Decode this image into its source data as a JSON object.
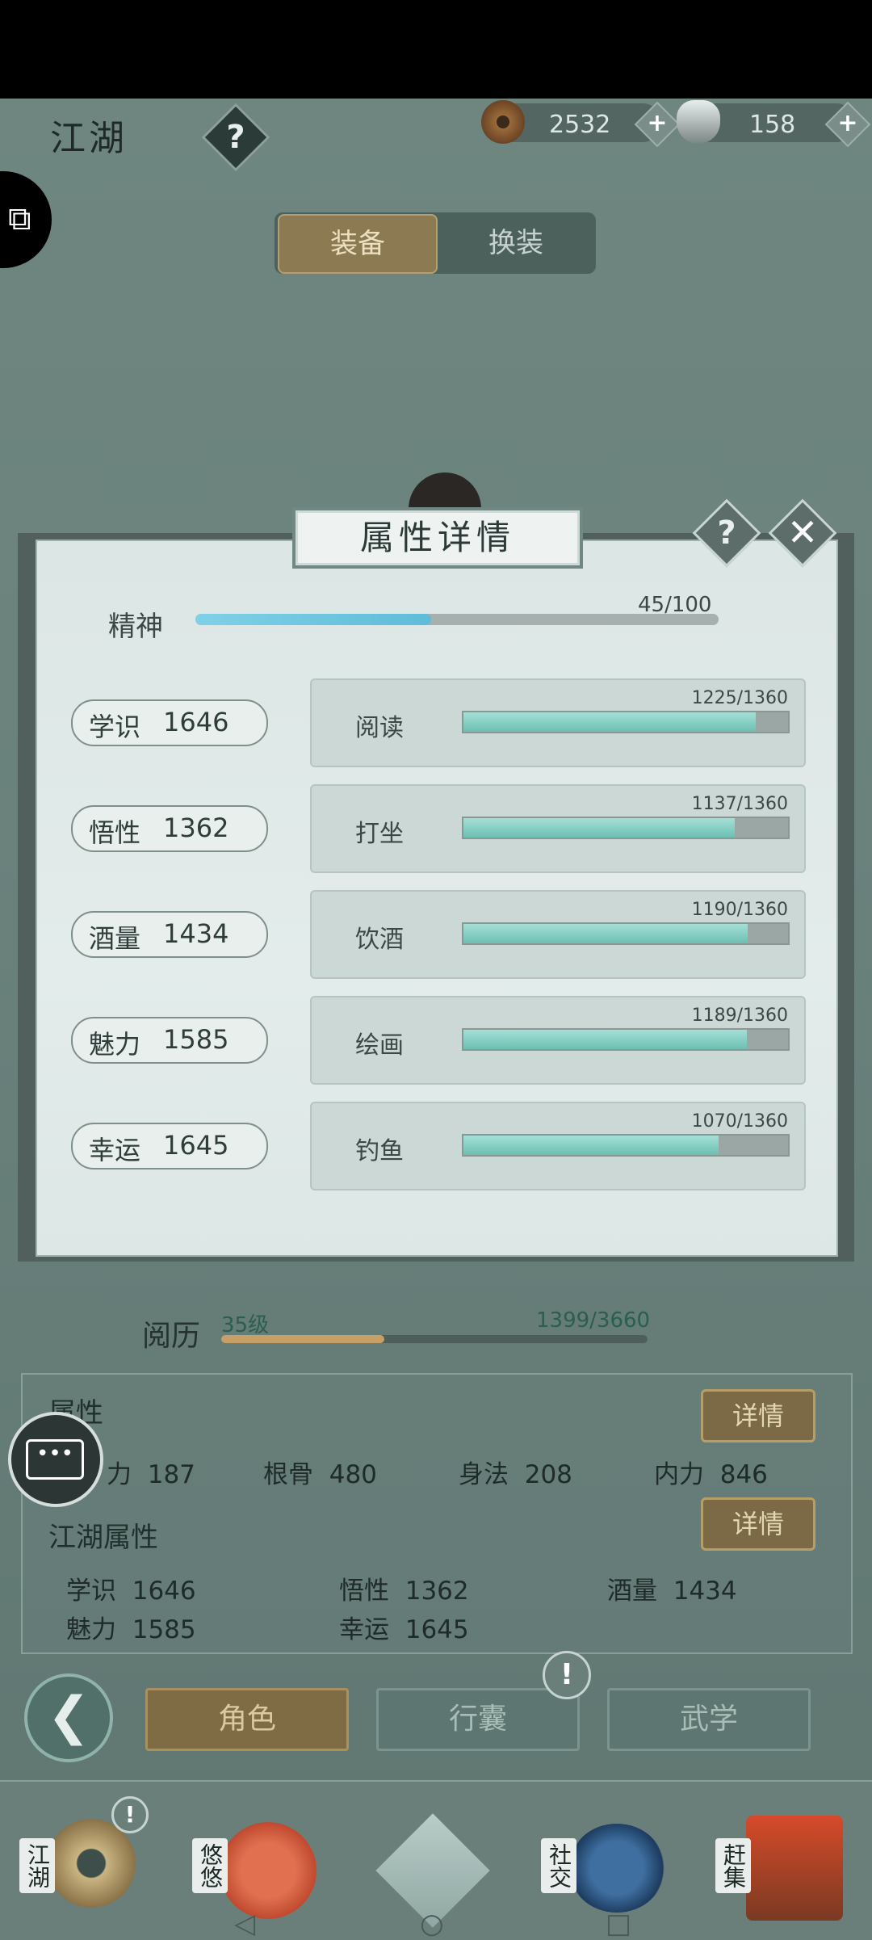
{
  "header": {
    "title": "江湖",
    "help": "?",
    "copper": "2532",
    "silver": "158",
    "plus": "+"
  },
  "segment": {
    "equip": "装备",
    "outfit": "换装"
  },
  "modal": {
    "title": "属性详情",
    "help": "?",
    "close": "✕",
    "spirit": {
      "label": "精神",
      "value": "45/100",
      "current": 45,
      "max": 100
    },
    "stats": [
      {
        "name": "学识",
        "value": "1646"
      },
      {
        "name": "悟性",
        "value": "1362"
      },
      {
        "name": "酒量",
        "value": "1434"
      },
      {
        "name": "魅力",
        "value": "1585"
      },
      {
        "name": "幸运",
        "value": "1645"
      }
    ],
    "activities": [
      {
        "name": "阅读",
        "progress": "1225/1360",
        "current": 1225,
        "max": 1360
      },
      {
        "name": "打坐",
        "progress": "1137/1360",
        "current": 1137,
        "max": 1360
      },
      {
        "name": "饮酒",
        "progress": "1190/1360",
        "current": 1190,
        "max": 1360
      },
      {
        "name": "绘画",
        "progress": "1189/1360",
        "current": 1189,
        "max": 1360
      },
      {
        "name": "钓鱼",
        "progress": "1070/1360",
        "current": 1070,
        "max": 1360
      }
    ]
  },
  "experience": {
    "label": "阅历",
    "level": "35级",
    "value": "1399/3660",
    "current": 1399,
    "max": 3660
  },
  "attributes": {
    "title": "属性",
    "detail": "详情",
    "items": [
      {
        "name": "力",
        "value": "187"
      },
      {
        "name": "根骨",
        "value": "480"
      },
      {
        "name": "身法",
        "value": "208"
      },
      {
        "name": "内力",
        "value": "846"
      }
    ]
  },
  "jianghu_attributes": {
    "title": "江湖属性",
    "detail": "详情",
    "items": [
      {
        "name": "学识",
        "value": "1646"
      },
      {
        "name": "悟性",
        "value": "1362"
      },
      {
        "name": "酒量",
        "value": "1434"
      },
      {
        "name": "魅力",
        "value": "1585"
      },
      {
        "name": "幸运",
        "value": "1645"
      }
    ]
  },
  "tabs": {
    "back": "❮",
    "role": "角色",
    "bag": "行囊",
    "martial": "武学",
    "notify": "!"
  },
  "bottom_nav": [
    {
      "label": "江湖"
    },
    {
      "label": "悠悠"
    },
    {
      "label": ""
    },
    {
      "label": "社交"
    },
    {
      "label": "赶集"
    }
  ],
  "colors": {
    "accent_gold": "#8c7a52",
    "bar_teal": "#6dbfb2",
    "spirit_blue": "#5fbcd8"
  }
}
